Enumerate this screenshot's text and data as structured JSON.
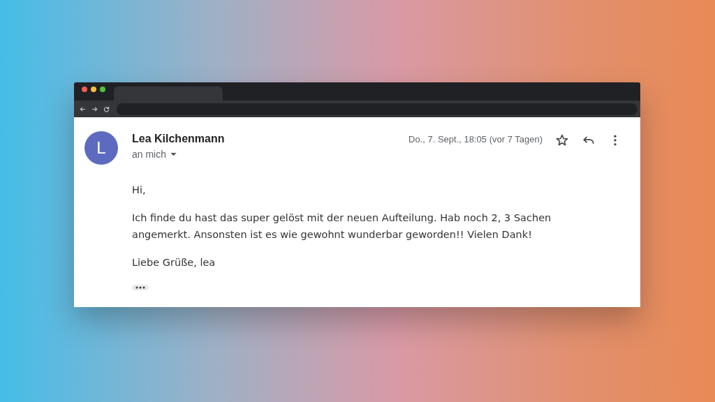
{
  "email": {
    "sender_initial": "L",
    "sender": "Lea Kilchenmann",
    "recipient": "an mich",
    "date": "Do., 7. Sept., 18:05 (vor 7 Tagen)",
    "starred": false,
    "body": [
      "Hi,",
      "Ich finde du hast das super gelöst mit der neuen Aufteilung. Hab noch 2, 3 Sachen angemerkt. Ansonsten ist es wie gewohnt wunderbar geworden!! Vielen Dank!",
      "Liebe Grüße, lea"
    ]
  }
}
